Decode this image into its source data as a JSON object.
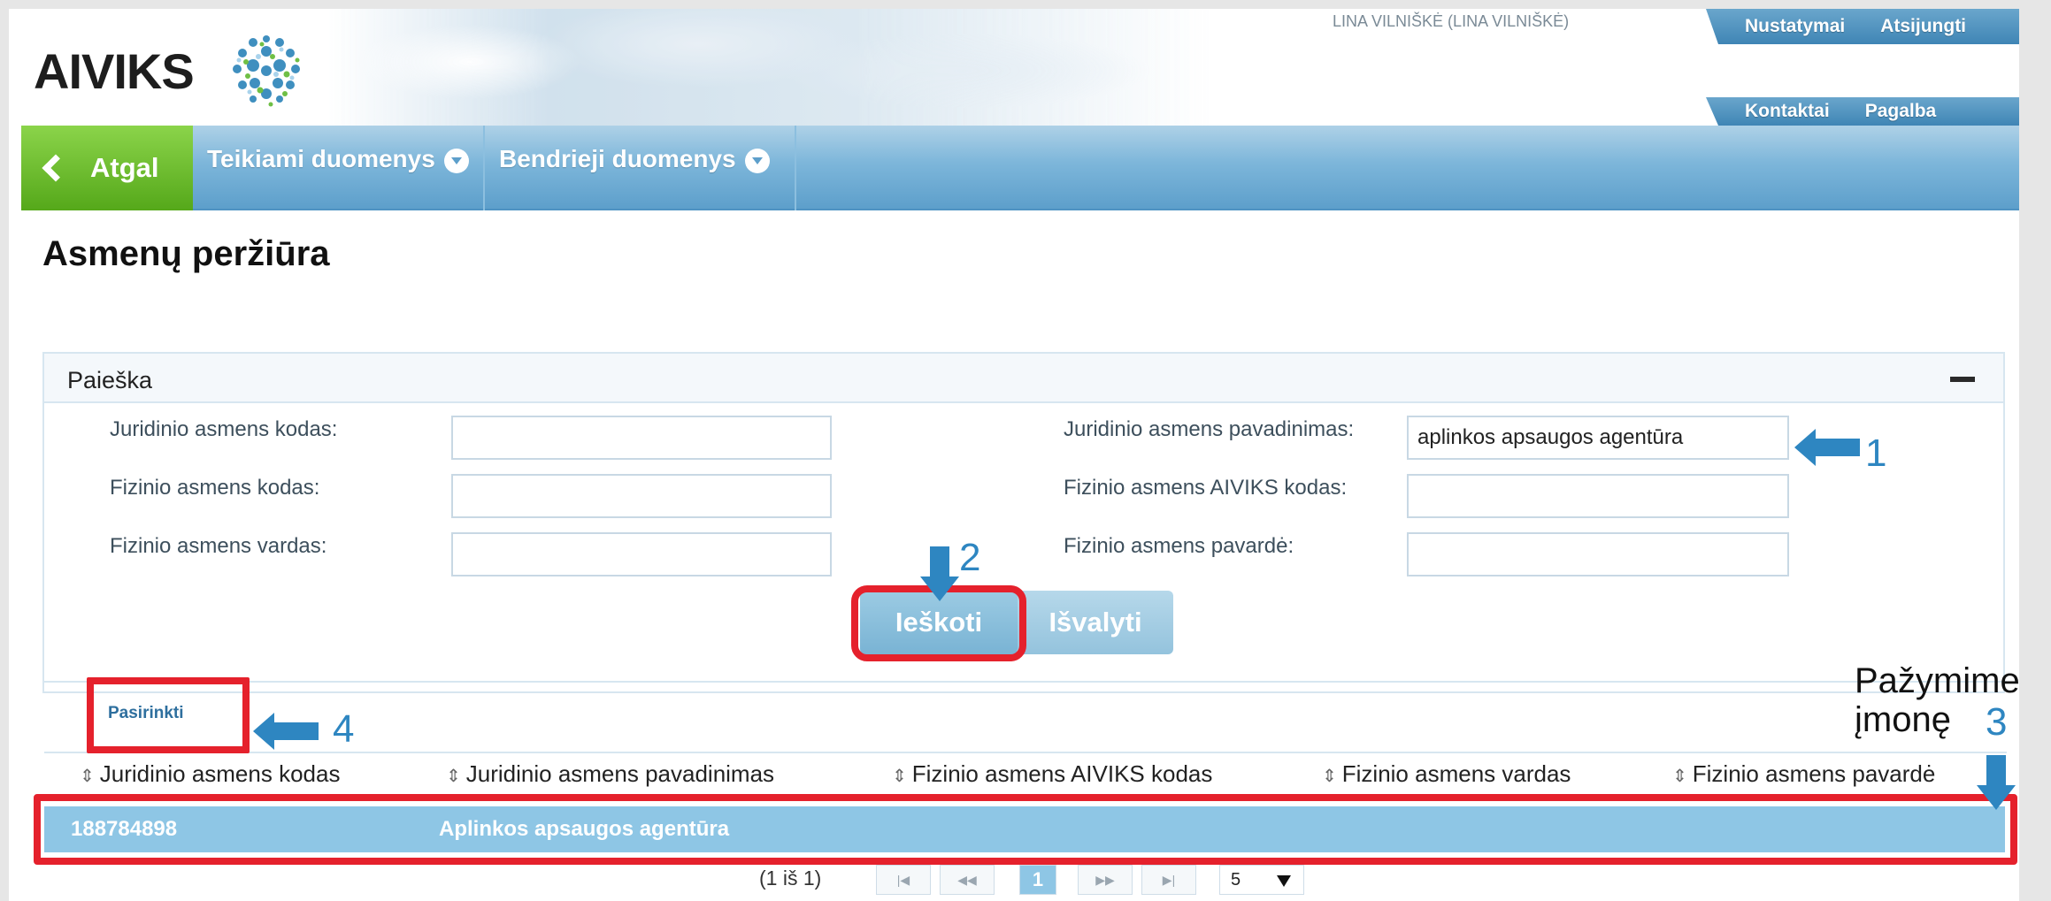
{
  "header": {
    "logo": "AIVIKS",
    "user": "LINA VILNIŠKĖ (LINA VILNIŠKĖ)",
    "top_links": [
      "Nustatymai",
      "Atsijungti"
    ],
    "second_links": [
      "Kontaktai",
      "Pagalba"
    ]
  },
  "nav": {
    "back": "Atgal",
    "items": [
      "Teikiami duomenys",
      "Bendrieji duomenys"
    ]
  },
  "page_title": "Asmenų peržiūra",
  "search": {
    "title": "Paieška",
    "fields": {
      "legal_code": {
        "label": "Juridinio asmens kodas:",
        "value": ""
      },
      "legal_name": {
        "label": "Juridinio asmens pavadinimas:",
        "value": "aplinkos apsaugos agentūra"
      },
      "person_code": {
        "label": "Fizinio asmens kodas:",
        "value": ""
      },
      "person_aiviks_code": {
        "label": "Fizinio asmens AIVIKS kodas:",
        "value": ""
      },
      "person_first_name": {
        "label": "Fizinio asmens vardas:",
        "value": ""
      },
      "person_last_name": {
        "label": "Fizinio asmens pavardė:",
        "value": ""
      }
    },
    "search_button": "Ieškoti",
    "clear_button": "Išvalyti"
  },
  "results": {
    "select_link": "Pasirinkti",
    "columns": [
      "Juridinio asmens kodas",
      "Juridinio asmens pavadinimas",
      "Fizinio asmens AIVIKS kodas",
      "Fizinio asmens vardas",
      "Fizinio asmens pavardė"
    ],
    "rows": [
      {
        "code": "188784898",
        "name": "Aplinkos apsaugos agentūra"
      }
    ],
    "pager": {
      "info": "(1 iš 1)",
      "current": "1",
      "per_page": "5"
    }
  },
  "annotations": {
    "step1": "1",
    "step2": "2",
    "step3": "3",
    "step4": "4",
    "note": "Pažymime įmonę",
    "highlight_color": "#e5212c",
    "arrow_color": "#2e86c1"
  }
}
